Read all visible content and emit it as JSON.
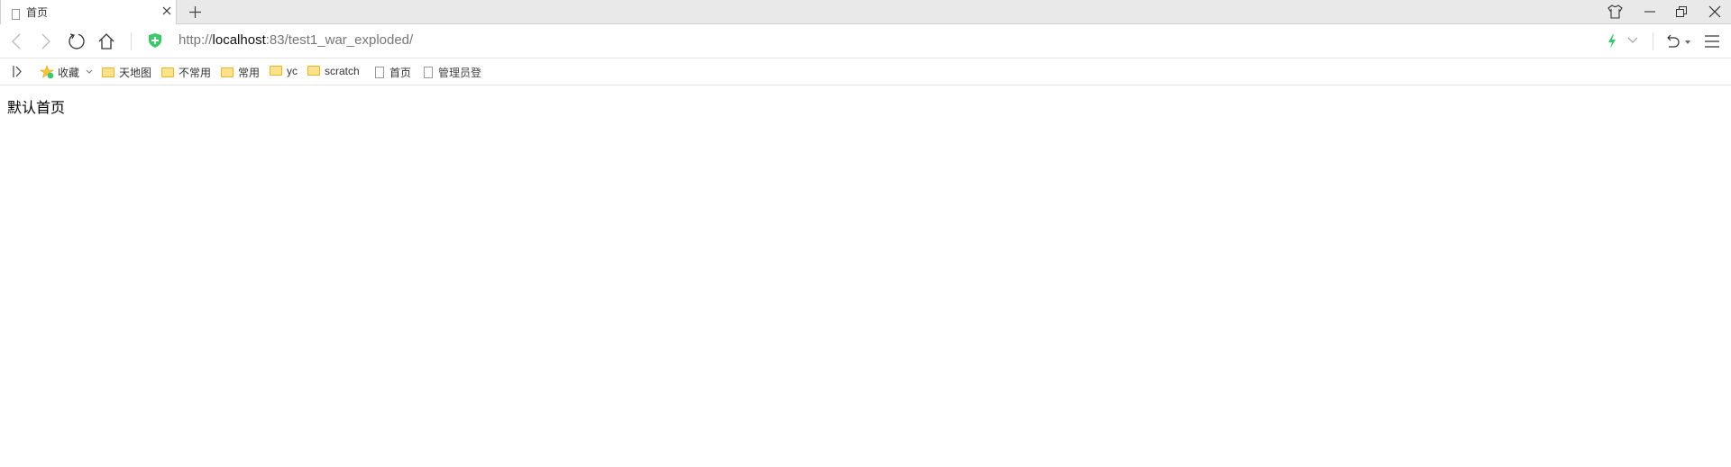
{
  "tab": {
    "title": "首页",
    "close_icon": "close-icon",
    "new_tab_icon": "plus-icon"
  },
  "window": {
    "skin_icon": "tshirt-icon",
    "minimize_icon": "minimize-icon",
    "restore_icon": "restore-icon",
    "close_icon": "close-icon"
  },
  "toolbar": {
    "url_prefix": "http://",
    "url_host": "localhost",
    "url_rest": ":83/test1_war_exploded/",
    "secure_icon": "shield-plus-icon",
    "accent": "#3cc86c"
  },
  "bookmarks": {
    "favorites": "收藏",
    "items": [
      {
        "label": "天地图",
        "type": "folder"
      },
      {
        "label": "不常用",
        "type": "folder"
      },
      {
        "label": "常用",
        "type": "folder"
      },
      {
        "label": "yc",
        "type": "folder"
      },
      {
        "label": "scratch",
        "type": "folder"
      },
      {
        "label": "首页",
        "type": "page"
      },
      {
        "label": "管理员登",
        "type": "page"
      }
    ]
  },
  "content": {
    "text": "默认首页"
  }
}
